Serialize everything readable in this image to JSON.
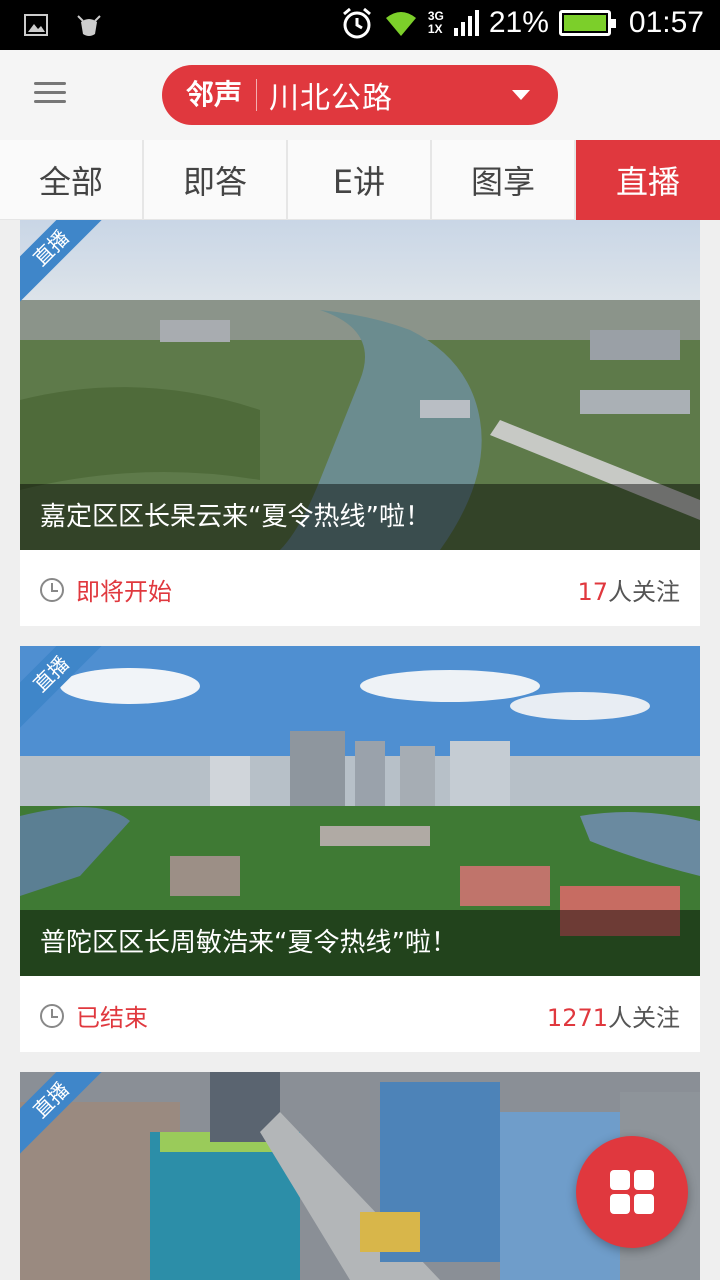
{
  "status_bar": {
    "network": "3G",
    "network2": "1X",
    "battery": "21%",
    "time": "01:57",
    "icons": [
      "gallery-icon",
      "android-debug-icon",
      "alarm-icon",
      "wifi-icon",
      "signal-icon",
      "battery-charging-icon"
    ]
  },
  "header": {
    "menu_icon": "hamburger-menu-icon",
    "brand": "邻声",
    "location": "川北公路",
    "dropdown_icon": "caret-down-icon"
  },
  "tabs": [
    {
      "label": "全部",
      "active": false
    },
    {
      "label": "即答",
      "active": false
    },
    {
      "label": "E讲",
      "active": false
    },
    {
      "label": "图享",
      "active": false
    },
    {
      "label": "直播",
      "active": true
    }
  ],
  "cards": [
    {
      "badge": "直播",
      "title": "嘉定区区长杲云来“夏令热线”啦！",
      "status": "即将开始",
      "followers_count": "17",
      "followers_suffix": "人关注"
    },
    {
      "badge": "直播",
      "title": "普陀区区长周敏浩来“夏令热线”啦！",
      "status": "已结束",
      "followers_count": "1271",
      "followers_suffix": "人关注"
    },
    {
      "badge": "直播",
      "title": "",
      "status": "",
      "followers_count": "",
      "followers_suffix": ""
    }
  ],
  "colors": {
    "accent": "#e0383e",
    "ribbon": "#3f86c9"
  },
  "fab": {
    "icon": "grid-apps-icon"
  }
}
